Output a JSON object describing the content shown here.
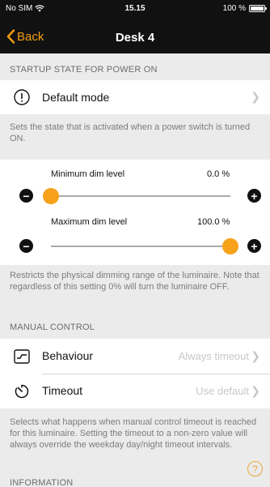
{
  "status_bar": {
    "carrier": "No SIM",
    "time": "15.15",
    "battery": "100 %",
    "battery_level": 1.0
  },
  "nav": {
    "back_label": "Back",
    "title": "Desk 4"
  },
  "startup": {
    "header": "STARTUP STATE FOR POWER ON",
    "row_label": "Default mode",
    "row_icon": "info-circle-icon",
    "footer": "Sets the state that is activated when a power switch is turned ON."
  },
  "dim": {
    "min": {
      "label": "Minimum dim level",
      "value_text": "0.0 %",
      "level": 0.0
    },
    "max": {
      "label": "Maximum dim level",
      "value_text": "100.0 %",
      "level": 1.0
    },
    "footer": "Restricts the physical dimming range of the luminaire. Note that regardless of this setting 0% will turn the luminaire OFF."
  },
  "manual": {
    "header": "MANUAL CONTROL",
    "rows": [
      {
        "label": "Behaviour",
        "value": "Always timeout",
        "icon": "behaviour-chart-icon"
      },
      {
        "label": "Timeout",
        "value": "Use default",
        "icon": "timer-icon"
      }
    ],
    "footer": "Selects what happens when manual control timeout is reached for this luminaire. Setting the timeout to a non-zero value will always override the weekday day/night timeout intervals."
  },
  "information": {
    "header": "INFORMATION"
  },
  "help_label": "?",
  "colors": {
    "accent": "#f7a012",
    "nav_background": "#111111",
    "page_background": "#ebebeb"
  }
}
